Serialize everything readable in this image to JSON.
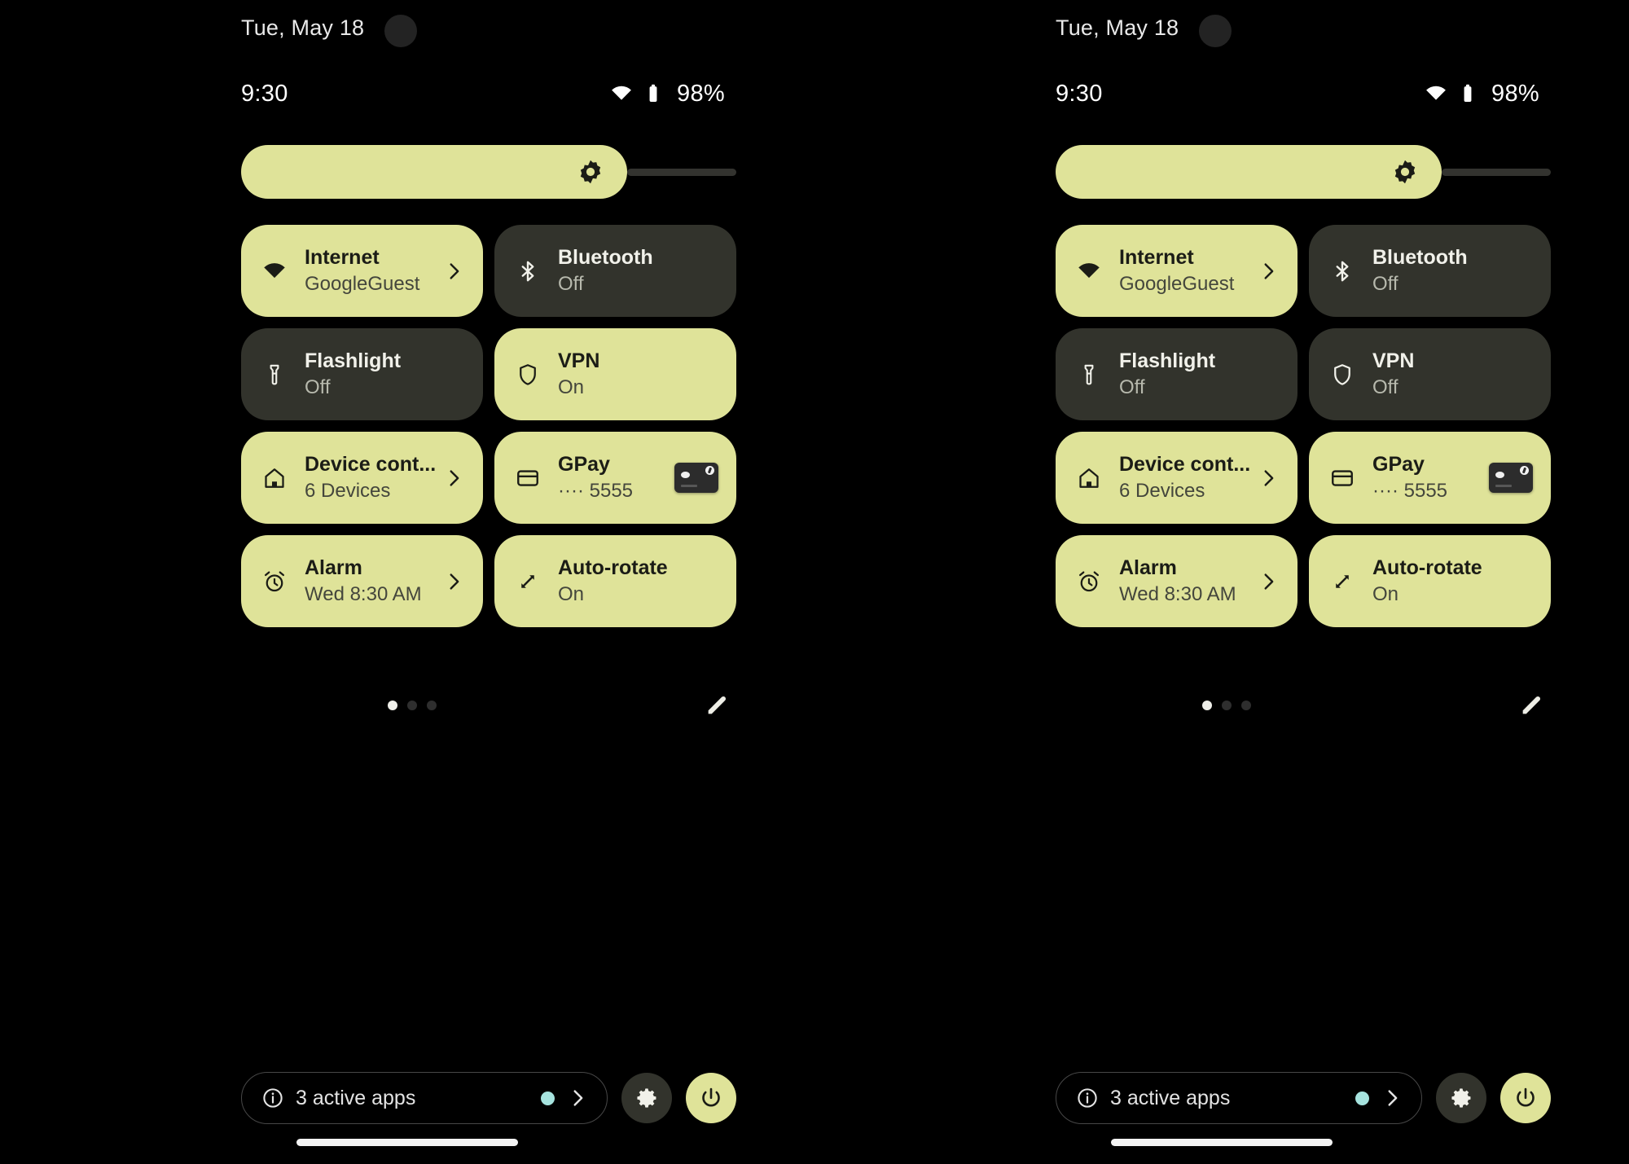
{
  "theme": {
    "background": "#000000",
    "tile_on_bg": "#dfe399",
    "tile_off_bg": "#32332c",
    "tile_on_text": "#1b1c16",
    "tile_off_text": "#f1f1ea",
    "accent_teal": "#a6e3de"
  },
  "panels": [
    {
      "id": "left",
      "status": {
        "date": "Tue, May 18",
        "clock": "9:30",
        "battery": "98%",
        "wifi_icon": "wifi-icon",
        "battery_icon": "battery-icon"
      },
      "brightness": {
        "icon": "brightness-icon",
        "level_percent": 78
      },
      "tiles": [
        {
          "name": "internet",
          "title": "Internet",
          "subtitle": "GoogleGuest",
          "state": "on",
          "icon": "wifi-icon",
          "trailing": "chevron-right-icon"
        },
        {
          "name": "bluetooth",
          "title": "Bluetooth",
          "subtitle": "Off",
          "state": "off",
          "icon": "bluetooth-icon",
          "trailing": "none"
        },
        {
          "name": "flashlight",
          "title": "Flashlight",
          "subtitle": "Off",
          "state": "off",
          "icon": "flashlight-icon",
          "trailing": "none"
        },
        {
          "name": "vpn",
          "title": "VPN",
          "subtitle": "On",
          "state": "on",
          "icon": "shield-icon",
          "trailing": "none"
        },
        {
          "name": "device-controls",
          "title": "Device cont...",
          "subtitle": "6 Devices",
          "state": "on",
          "icon": "home-icon",
          "trailing": "chevron-right-icon"
        },
        {
          "name": "gpay",
          "title": "GPay",
          "subtitle": "···· 5555",
          "state": "on",
          "icon": "credit-card-icon",
          "trailing": "card-thumbnail"
        },
        {
          "name": "alarm",
          "title": "Alarm",
          "subtitle": "Wed 8:30 AM",
          "state": "on",
          "icon": "alarm-clock-icon",
          "trailing": "chevron-right-icon"
        },
        {
          "name": "auto-rotate",
          "title": "Auto-rotate",
          "subtitle": "On",
          "state": "on",
          "icon": "auto-rotate-icon",
          "trailing": "none"
        }
      ],
      "pager": {
        "pages": 3,
        "active_index": 0,
        "edit_icon": "pencil-icon"
      },
      "footer": {
        "active_apps_label": "3 active apps",
        "info_icon": "info-icon",
        "chevron_icon": "chevron-right-icon",
        "settings_icon": "gear-icon",
        "power_icon": "power-icon"
      }
    },
    {
      "id": "right",
      "status": {
        "date": "Tue, May 18",
        "clock": "9:30",
        "battery": "98%",
        "wifi_icon": "wifi-icon",
        "battery_icon": "battery-icon"
      },
      "brightness": {
        "icon": "brightness-icon",
        "level_percent": 78
      },
      "tiles": [
        {
          "name": "internet",
          "title": "Internet",
          "subtitle": "GoogleGuest",
          "state": "on",
          "icon": "wifi-icon",
          "trailing": "chevron-right-icon"
        },
        {
          "name": "bluetooth",
          "title": "Bluetooth",
          "subtitle": "Off",
          "state": "off",
          "icon": "bluetooth-icon",
          "trailing": "none"
        },
        {
          "name": "flashlight",
          "title": "Flashlight",
          "subtitle": "Off",
          "state": "off",
          "icon": "flashlight-icon",
          "trailing": "none"
        },
        {
          "name": "vpn",
          "title": "VPN",
          "subtitle": "Off",
          "state": "off",
          "icon": "shield-icon",
          "trailing": "none"
        },
        {
          "name": "device-controls",
          "title": "Device cont...",
          "subtitle": "6 Devices",
          "state": "on",
          "icon": "home-icon",
          "trailing": "chevron-right-icon"
        },
        {
          "name": "gpay",
          "title": "GPay",
          "subtitle": "···· 5555",
          "state": "on",
          "icon": "credit-card-icon",
          "trailing": "card-thumbnail"
        },
        {
          "name": "alarm",
          "title": "Alarm",
          "subtitle": "Wed 8:30 AM",
          "state": "on",
          "icon": "alarm-clock-icon",
          "trailing": "chevron-right-icon"
        },
        {
          "name": "auto-rotate",
          "title": "Auto-rotate",
          "subtitle": "On",
          "state": "on",
          "icon": "auto-rotate-icon",
          "trailing": "none"
        }
      ],
      "pager": {
        "pages": 3,
        "active_index": 0,
        "edit_icon": "pencil-icon"
      },
      "footer": {
        "active_apps_label": "3 active apps",
        "info_icon": "info-icon",
        "chevron_icon": "chevron-right-icon",
        "settings_icon": "gear-icon",
        "power_icon": "power-icon"
      }
    }
  ]
}
